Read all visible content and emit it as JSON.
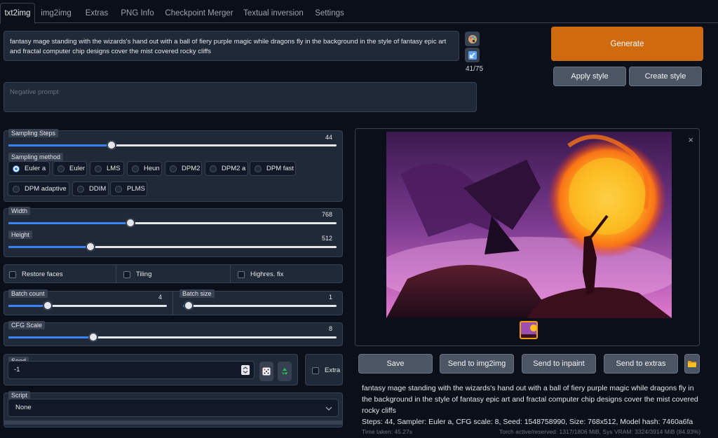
{
  "tabs": [
    "txt2img",
    "img2img",
    "Extras",
    "PNG Info",
    "Checkpoint Merger",
    "Textual inversion",
    "Settings"
  ],
  "prompt": {
    "value": "fantasy mage standing with the wizards's hand out with a ball of fiery purple magic  while dragons fly in the background in the style of fantasy epic art and fractal computer chip designs cover the mist covered rocky cliffs",
    "token_count": "41/75"
  },
  "negative_prompt": {
    "placeholder": "Negative prompt"
  },
  "buttons": {
    "generate": "Generate",
    "apply_style": "Apply style",
    "create_style": "Create style"
  },
  "sampling_steps": {
    "label": "Sampling Steps",
    "value": "44",
    "fraction": 0.297
  },
  "sampling_method": {
    "label": "Sampling method",
    "options": [
      "Euler a",
      "Euler",
      "LMS",
      "Heun",
      "DPM2",
      "DPM2 a",
      "DPM fast",
      "DPM adaptive",
      "DDIM",
      "PLMS"
    ],
    "selected": "Euler a"
  },
  "width": {
    "label": "Width",
    "value": "768",
    "fraction": 0.355
  },
  "height": {
    "label": "Height",
    "value": "512",
    "fraction": 0.232
  },
  "checks": {
    "restore_faces": "Restore faces",
    "tiling": "Tiling",
    "highres_fix": "Highres. fix"
  },
  "batch_count": {
    "label": "Batch count",
    "value": "4",
    "fraction": 0.214
  },
  "batch_size": {
    "label": "Batch size",
    "value": "1",
    "fraction": 0.0
  },
  "cfg_scale": {
    "label": "CFG Scale",
    "value": "8",
    "fraction": 0.241
  },
  "seed": {
    "label": "Seed",
    "value": "-1",
    "extra_label": "Extra"
  },
  "script": {
    "label": "Script",
    "value": "None"
  },
  "output": {
    "save": "Save",
    "send_img2img": "Send to img2img",
    "send_inpaint": "Send to inpaint",
    "send_extras": "Send to extras",
    "info_prompt": "fantasy mage standing with the wizards's hand out with a ball of fiery purple magic while dragons fly in the background in the style of fantasy epic art and fractal computer chip designs cover the mist covered rocky cliffs",
    "info_params": "Steps: 44, Sampler: Euler a, CFG scale: 8, Seed: 1548758990, Size: 768x512, Model hash: 7460a6fa",
    "time_taken": "Time taken: 45.27s",
    "torch_info": "Torch active/reserved: 1317/1806 MiB, Sys VRAM: 3324/3914 MiB (84.93%)"
  },
  "colors": {
    "accent": "#3b82f6",
    "generate": "#d06a0f",
    "background": "#0b0f19"
  }
}
